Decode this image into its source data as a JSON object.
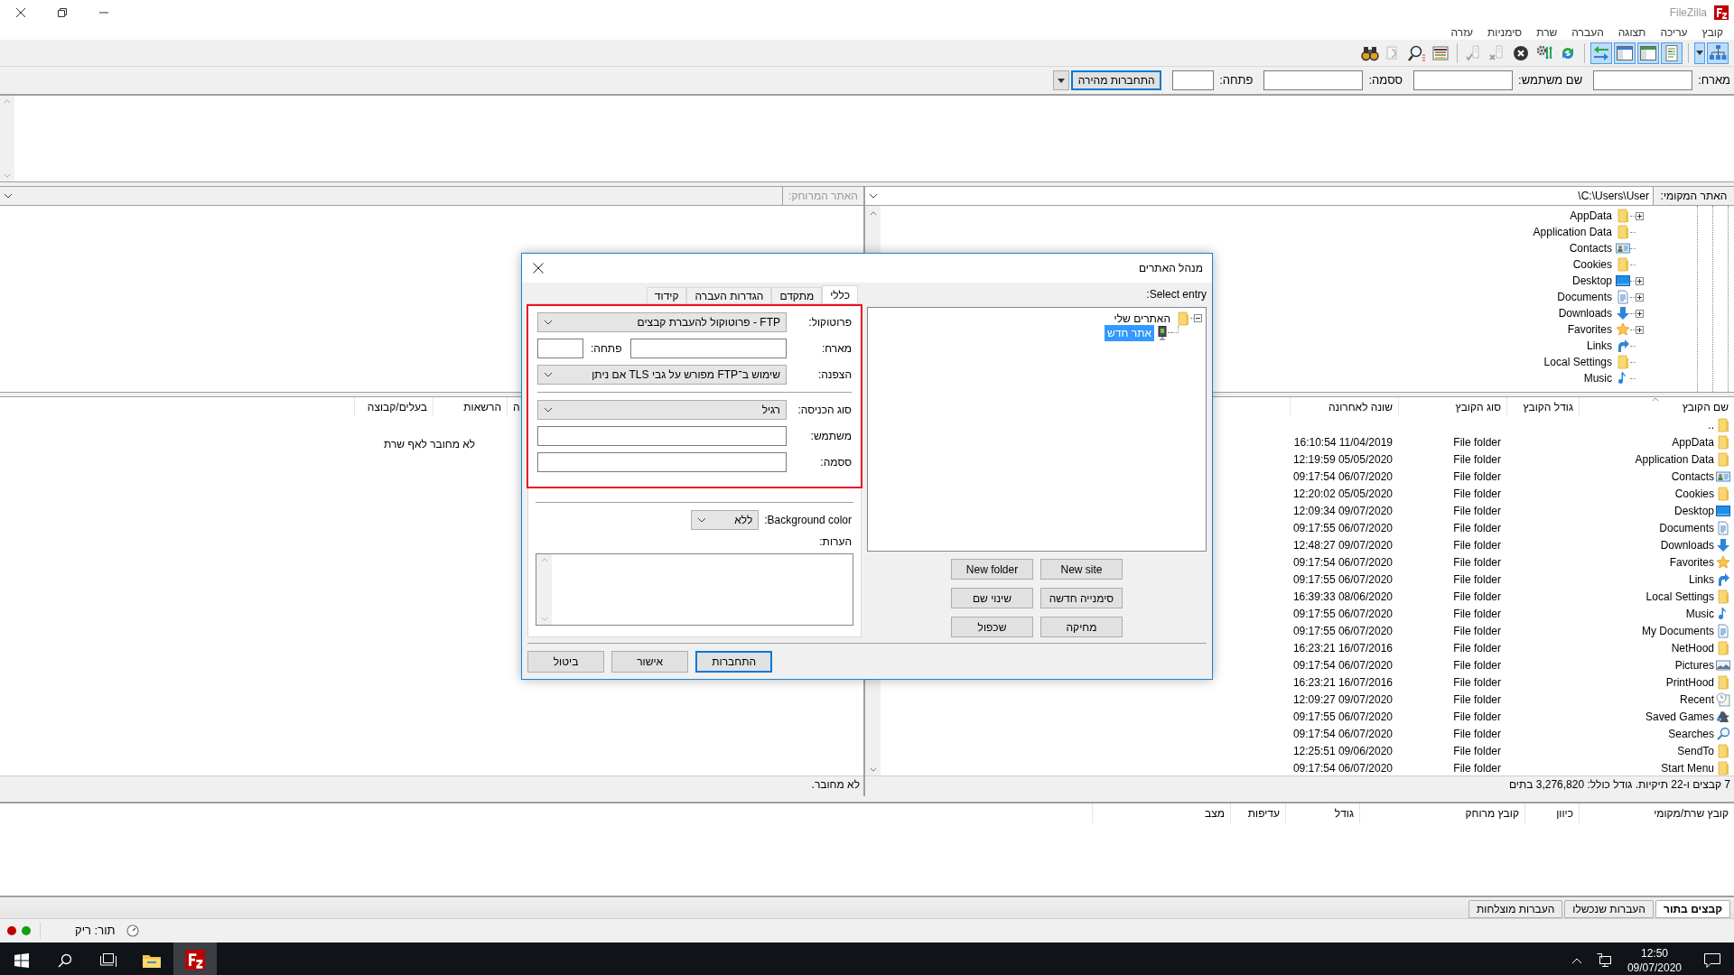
{
  "window": {
    "title": "FileZilla"
  },
  "menu": [
    "קובץ",
    "עריכה",
    "תצוגה",
    "העברה",
    "שרת",
    "סימניות",
    "עזרה"
  ],
  "toolbar": [
    [
      {
        "kind": "site-manager",
        "on": true,
        "disabled": false
      },
      {
        "kind": "dropdown",
        "on": true,
        "disabled": false
      }
    ],
    [
      {
        "kind": "message-log",
        "on": true,
        "disabled": false
      },
      {
        "kind": "local-tree",
        "on": true,
        "disabled": false
      },
      {
        "kind": "remote-tree",
        "on": true,
        "disabled": false
      },
      {
        "kind": "transfer-queue",
        "on": true,
        "disabled": false
      }
    ],
    [
      {
        "kind": "refresh",
        "on": false,
        "disabled": false
      },
      {
        "kind": "process-queue",
        "on": false,
        "disabled": false
      },
      {
        "kind": "cancel",
        "on": false,
        "disabled": false
      },
      {
        "kind": "disconnect",
        "on": false,
        "disabled": true
      },
      {
        "kind": "reconnect",
        "on": false,
        "disabled": true
      }
    ],
    [
      {
        "kind": "filter",
        "on": false,
        "disabled": false
      },
      {
        "kind": "compare",
        "on": false,
        "disabled": false
      },
      {
        "kind": "sync",
        "on": false,
        "disabled": true
      },
      {
        "kind": "find",
        "on": false,
        "disabled": false
      }
    ]
  ],
  "quickconnect": {
    "fields": [
      {
        "label": "מארח:",
        "kind": "wide"
      },
      {
        "label": "שם משתמש:",
        "kind": "wide"
      },
      {
        "label": "ססמה:",
        "kind": "wide"
      },
      {
        "label": "פתחה:",
        "kind": "narrow"
      }
    ],
    "button": "התחברות מהירה"
  },
  "local_site": {
    "label": "האתר המקומי:",
    "path": "C:\\Users\\User\\"
  },
  "remote_site": {
    "label": "האתר המרוחק:",
    "disabled": true
  },
  "local_tree": [
    {
      "name": "AppData",
      "kind": "folder",
      "expandable": true
    },
    {
      "name": "Application Data",
      "kind": "folder",
      "expandable": false
    },
    {
      "name": "Contacts",
      "kind": "contacts",
      "expandable": false
    },
    {
      "name": "Cookies",
      "kind": "folder",
      "expandable": false
    },
    {
      "name": "Desktop",
      "kind": "desktop",
      "expandable": true
    },
    {
      "name": "Documents",
      "kind": "documents",
      "expandable": true
    },
    {
      "name": "Downloads",
      "kind": "downloads",
      "expandable": true
    },
    {
      "name": "Favorites",
      "kind": "favorites",
      "expandable": true
    },
    {
      "name": "Links",
      "kind": "links",
      "expandable": false
    },
    {
      "name": "Local Settings",
      "kind": "folder",
      "expandable": false
    },
    {
      "name": "Music",
      "kind": "music",
      "expandable": false
    }
  ],
  "local_files": {
    "columns": [
      "שם הקובץ",
      "גודל הקובץ",
      "סוג הקובץ",
      "שונה לאחרונה"
    ],
    "rows": [
      {
        "name": "..",
        "kind": "folder"
      },
      {
        "name": "AppData",
        "kind": "folder",
        "type": "File folder",
        "modified": "16:10:54 11/04/2019"
      },
      {
        "name": "Application Data",
        "kind": "folder",
        "type": "File folder",
        "modified": "12:19:59 05/05/2020"
      },
      {
        "name": "Contacts",
        "kind": "contacts",
        "type": "File folder",
        "modified": "09:17:54 06/07/2020"
      },
      {
        "name": "Cookies",
        "kind": "folder",
        "type": "File folder",
        "modified": "12:20:02 05/05/2020"
      },
      {
        "name": "Desktop",
        "kind": "desktop",
        "type": "File folder",
        "modified": "12:09:34 09/07/2020"
      },
      {
        "name": "Documents",
        "kind": "documents",
        "type": "File folder",
        "modified": "09:17:55 06/07/2020"
      },
      {
        "name": "Downloads",
        "kind": "downloads",
        "type": "File folder",
        "modified": "12:48:27 09/07/2020"
      },
      {
        "name": "Favorites",
        "kind": "favorites",
        "type": "File folder",
        "modified": "09:17:54 06/07/2020"
      },
      {
        "name": "Links",
        "kind": "links",
        "type": "File folder",
        "modified": "09:17:55 06/07/2020"
      },
      {
        "name": "Local Settings",
        "kind": "folder",
        "type": "File folder",
        "modified": "16:39:33 08/06/2020"
      },
      {
        "name": "Music",
        "kind": "music",
        "type": "File folder",
        "modified": "09:17:55 06/07/2020"
      },
      {
        "name": "My Documents",
        "kind": "documents",
        "type": "File folder",
        "modified": "09:17:55 06/07/2020"
      },
      {
        "name": "NetHood",
        "kind": "folder",
        "type": "File folder",
        "modified": "16:23:21 16/07/2016"
      },
      {
        "name": "Pictures",
        "kind": "pictures",
        "type": "File folder",
        "modified": "09:17:54 06/07/2020"
      },
      {
        "name": "PrintHood",
        "kind": "folder",
        "type": "File folder",
        "modified": "16:23:21 16/07/2016"
      },
      {
        "name": "Recent",
        "kind": "recent",
        "type": "File folder",
        "modified": "12:09:27 09/07/2020"
      },
      {
        "name": "Saved Games",
        "kind": "games",
        "type": "File folder",
        "modified": "09:17:55 06/07/2020"
      },
      {
        "name": "Searches",
        "kind": "searches",
        "type": "File folder",
        "modified": "09:17:54 06/07/2020"
      },
      {
        "name": "SendTo",
        "kind": "folder",
        "type": "File folder",
        "modified": "12:25:51 09/06/2020"
      },
      {
        "name": "Start Menu",
        "kind": "folder",
        "type": "File folder",
        "modified": "09:17:54 06/07/2020"
      }
    ]
  },
  "local_status": "7 קבצים ו-22 תיקיות. גודל כולל: 3,276,820 בתים",
  "remote_files": {
    "columns": [
      "ה",
      "הרשאות",
      "בעלים/קבוצה"
    ],
    "message": "לא מחובר לאף שרת"
  },
  "remote_status": "לא מחובר.",
  "queue": {
    "columns": [
      "קובץ שרת/מקומי",
      "כיוון",
      "קובץ מרוחק",
      "גודל",
      "עדיפות",
      "מצב"
    ],
    "tabs": [
      {
        "label": "קבצים בתור",
        "selected": true
      },
      {
        "label": "העברות שנכשלו",
        "selected": false
      },
      {
        "label": "העברות מוצלחות",
        "selected": false
      }
    ]
  },
  "status_bar": {
    "lights": [
      {
        "color": "#c00000"
      },
      {
        "color": "#10a010"
      }
    ],
    "queue": "תור: ריק"
  },
  "site_manager": {
    "title": "מנהל האתרים",
    "select_label": "Select entry:",
    "tree": [
      {
        "name": "האתרים שלי",
        "kind": "folder",
        "expanded": true,
        "selected": false,
        "children": [
          {
            "name": "אתר חדש",
            "kind": "site",
            "selected": true
          }
        ]
      }
    ],
    "buttons": [
      "New site",
      "New folder",
      "סימנייה חדשה",
      "שינוי שם",
      "מחיקה",
      "שכפול"
    ],
    "tabs": [
      {
        "label": "כללי",
        "selected": true
      },
      {
        "label": "מתקדם",
        "selected": false
      },
      {
        "label": "הגדרות העברה",
        "selected": false
      },
      {
        "label": "קידוד",
        "selected": false
      }
    ],
    "highlighted": true,
    "connection_fields": [
      {
        "label": "פרוטוקול:",
        "kind": "select",
        "value": "FTP - פרוטוקול להעברת קבצים"
      },
      {
        "label": "מארח:",
        "kind": "host",
        "port_label": "פתחה:"
      },
      {
        "label": "הצפנה:",
        "kind": "select",
        "value": "שימוש ב־FTP מפורש על גבי TLS אם ניתן"
      }
    ],
    "login_fields": [
      {
        "label": "סוג הכניסה:",
        "kind": "select",
        "value": "רגיל"
      },
      {
        "label": "משתמש:",
        "kind": "text"
      },
      {
        "label": "ססמה:",
        "kind": "text"
      }
    ],
    "background_color": {
      "label": "Background color:",
      "value": "ללא"
    },
    "notes_label": "הערות:",
    "actions": [
      {
        "label": "התחברות",
        "default": true
      },
      {
        "label": "אישור",
        "default": false
      },
      {
        "label": "ביטול",
        "default": false
      }
    ]
  },
  "taskbar": {
    "items": [
      {
        "kind": "start",
        "selected": false
      },
      {
        "kind": "search",
        "selected": false
      },
      {
        "kind": "task-view",
        "selected": false
      },
      {
        "kind": "explorer",
        "selected": false
      },
      {
        "kind": "filezilla",
        "selected": true
      }
    ],
    "time": "12:50",
    "date": "09/07/2020"
  }
}
